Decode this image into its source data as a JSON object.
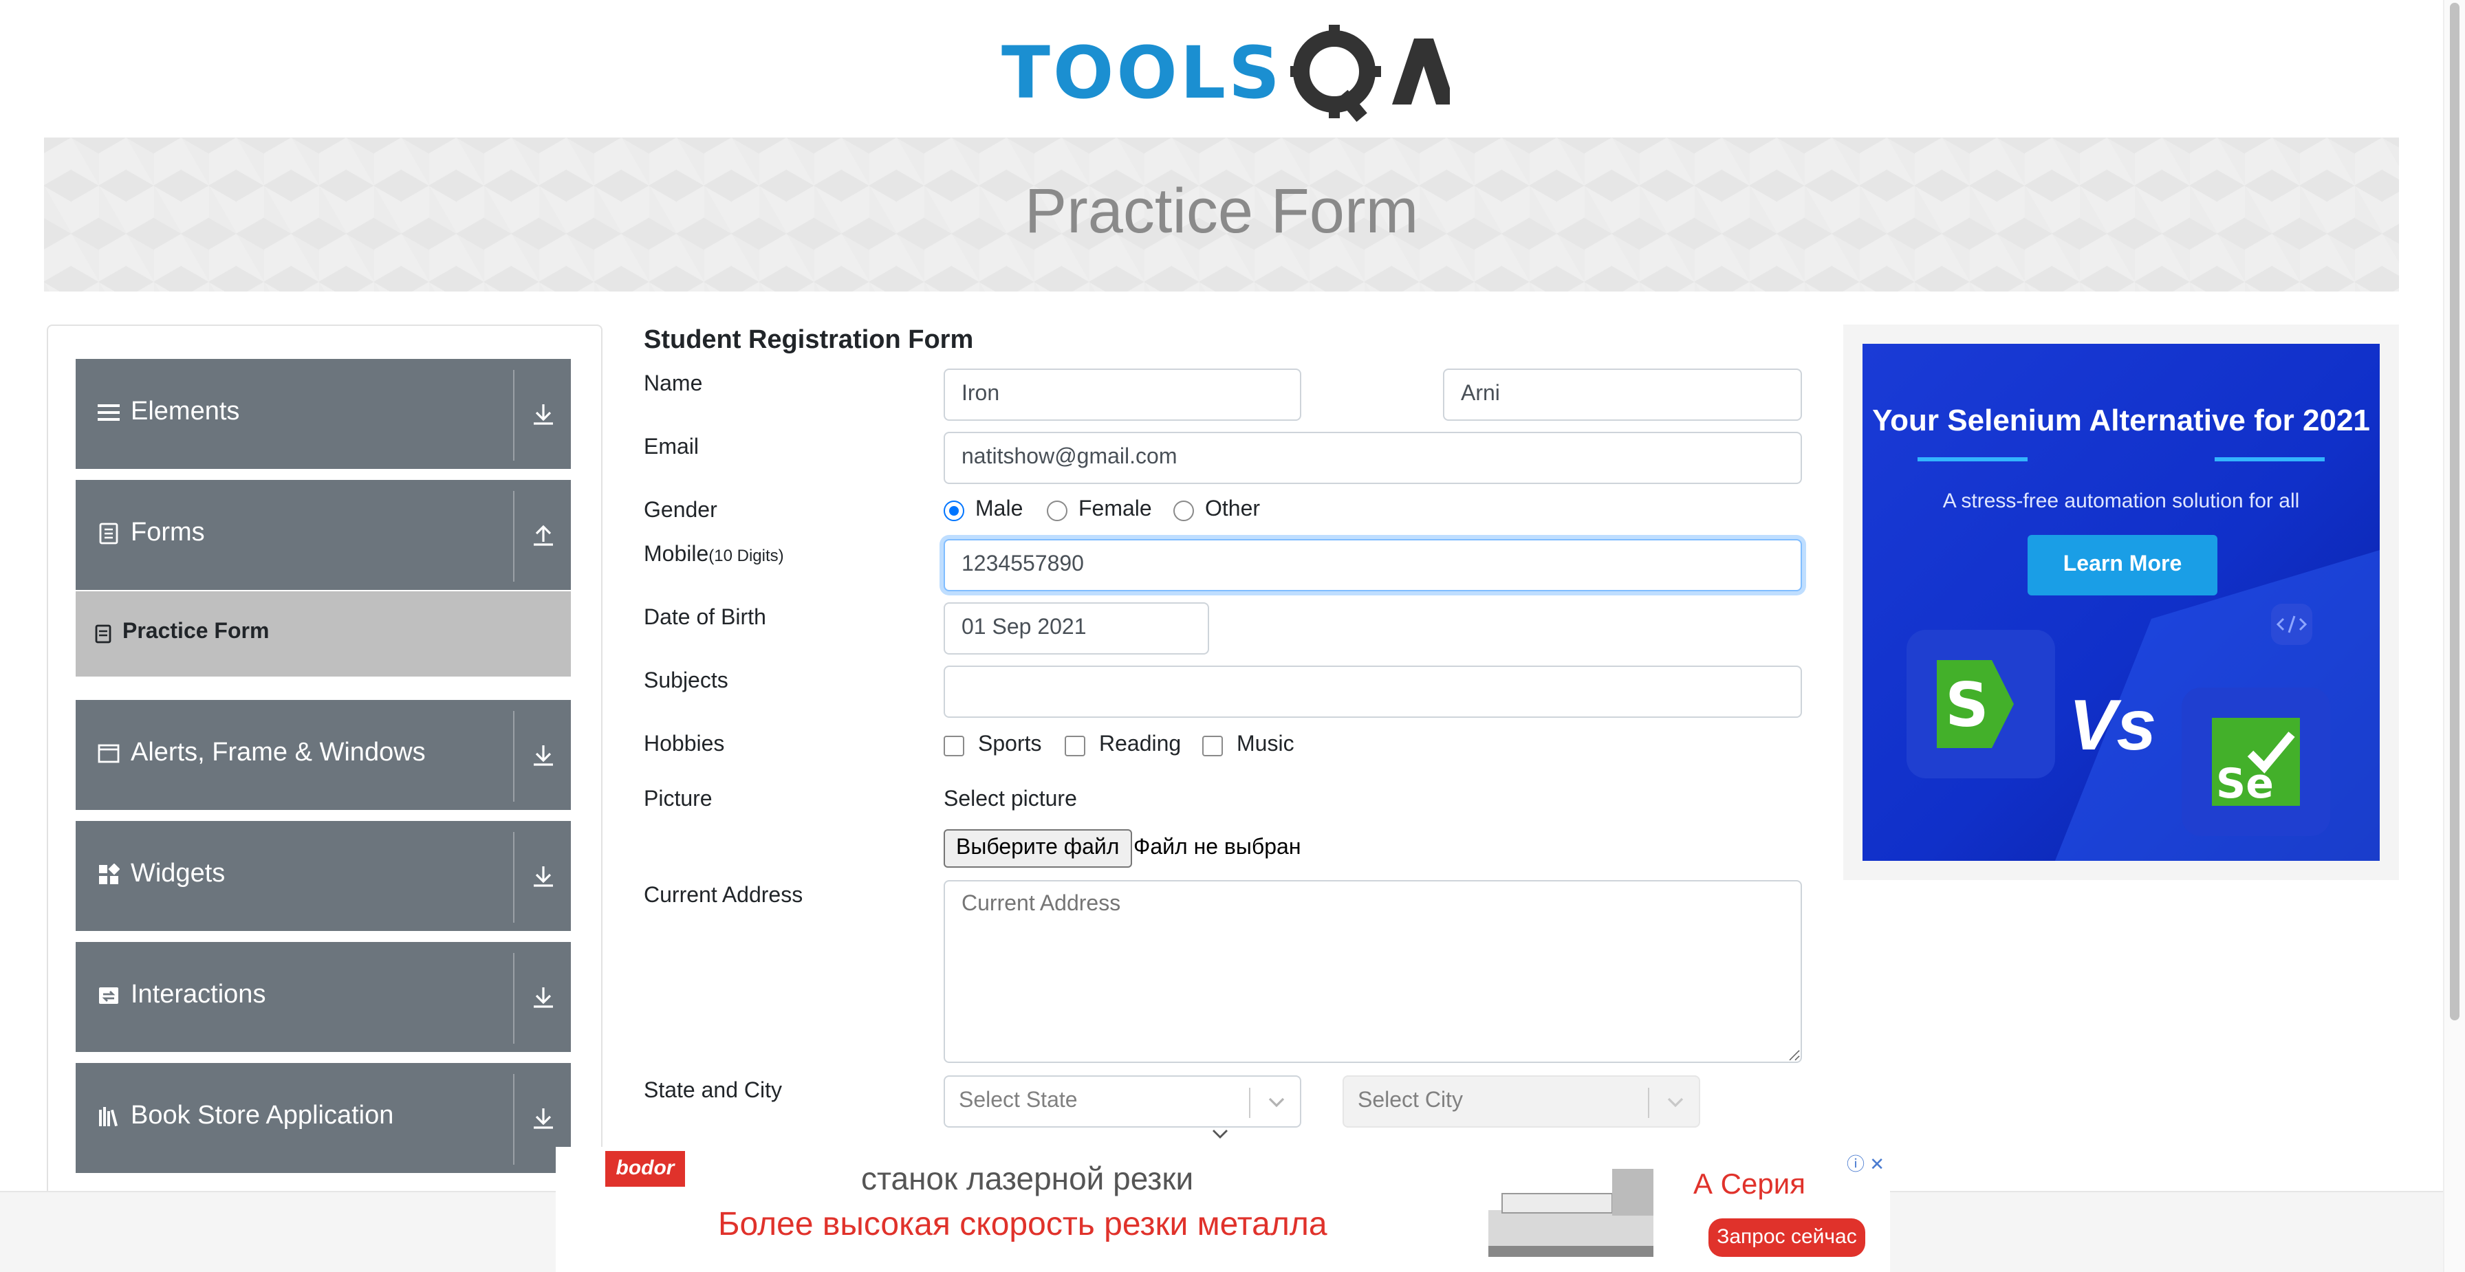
{
  "header": {
    "logo_text": "TOOLS",
    "logo_suffix": "QA",
    "page_title": "Practice Form"
  },
  "sidebar": {
    "groups": [
      {
        "label": "Elements",
        "icon": "hamburger-icon",
        "arrow": "download-icon"
      },
      {
        "label": "Forms",
        "icon": "document-icon",
        "arrow": "upload-icon"
      },
      {
        "label": "Alerts, Frame & Windows",
        "icon": "window-icon",
        "arrow": "download-icon"
      },
      {
        "label": "Widgets",
        "icon": "widgets-icon",
        "arrow": "download-icon"
      },
      {
        "label": "Interactions",
        "icon": "interactions-icon",
        "arrow": "download-icon"
      },
      {
        "label": "Book Store Application",
        "icon": "books-icon",
        "arrow": "download-icon"
      }
    ],
    "active_item": {
      "label": "Practice Form",
      "icon": "form-icon"
    }
  },
  "form": {
    "title": "Student Registration Form",
    "labels": {
      "name": "Name",
      "email": "Email",
      "gender": "Gender",
      "mobile": "Mobile",
      "mobile_hint": "(10 Digits)",
      "dob": "Date of Birth",
      "subjects": "Subjects",
      "hobbies": "Hobbies",
      "picture": "Picture",
      "address": "Current Address",
      "state_city": "State and City"
    },
    "first_name": "Iron",
    "last_name": "Arni",
    "email": "natitshow@gmail.com",
    "gender_options": [
      "Male",
      "Female",
      "Other"
    ],
    "gender_selected": "Male",
    "mobile": "1234557890",
    "dob": "01 Sep 2021",
    "subjects": "",
    "hobbies": [
      "Sports",
      "Reading",
      "Music"
    ],
    "picture_label": "Select picture",
    "file_button": "Выберите файл",
    "file_status": "Файл не выбран",
    "address_placeholder": "Current Address",
    "state_placeholder": "Select State",
    "city_placeholder": "Select City"
  },
  "ad_right": {
    "headline": "Your Selenium Alternative for 2021",
    "subline": "A stress-free automation solution for all",
    "button": "Learn More",
    "vs": "Vs",
    "tile_left_letter": "S",
    "tile_right_letters": "Se",
    "colors": {
      "background": "#1030c9",
      "button": "#1a9ee6",
      "green": "#43b02a"
    }
  },
  "ad_bottom": {
    "brand": "bodor",
    "line1": "станок лазерной резки",
    "line2": "Более высокая скорость резки металла",
    "series": "А Серия",
    "cta": "Запрос сейчас"
  },
  "colors": {
    "sidebar_group": "#6c757d",
    "active_item": "#bfbfbf",
    "logo_blue": "#1b8fd1",
    "logo_dark": "#333333",
    "accent": "#0075ff"
  }
}
